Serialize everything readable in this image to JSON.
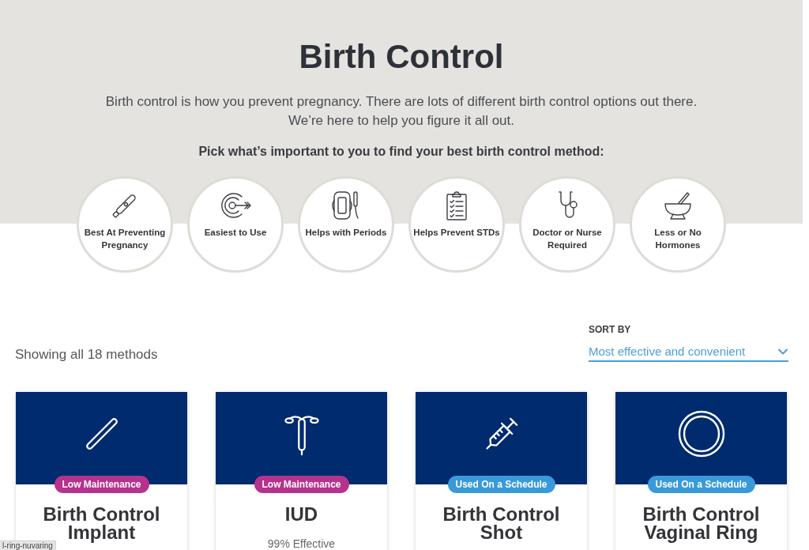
{
  "header": {
    "title": "Birth Control",
    "intro": "Birth control is how you prevent pregnancy. There are lots of different birth control options out there. We’re here to help you figure it all out.",
    "prompt": "Pick what’s important to you to find your best birth control method:"
  },
  "filters": [
    {
      "label": "Best At Preventing Pregnancy",
      "selected": false
    },
    {
      "label": "Easiest to Use",
      "selected": false
    },
    {
      "label": "Helps with Periods",
      "selected": false
    },
    {
      "label": "Helps Prevent STDs",
      "selected": false
    },
    {
      "label": "Doctor or Nurse Required",
      "selected": false
    },
    {
      "label": "Less or No Hormones",
      "selected": false
    }
  ],
  "results": {
    "count_text": "Showing all 18 methods",
    "sort": {
      "label": "SORT BY",
      "value": "Most effective and convenient"
    }
  },
  "cards": [
    {
      "badge": {
        "text": "Low Maintenance",
        "color": "#b5338c"
      },
      "title": "Birth Control Implant"
    },
    {
      "badge": {
        "text": "Low Maintenance",
        "color": "#b5338c"
      },
      "title": "IUD",
      "effectiveness": "99% Effective"
    },
    {
      "badge": {
        "text": "Used On a Schedule",
        "color": "#3a9ad9"
      },
      "title": "Birth Control Shot"
    },
    {
      "badge": {
        "text": "Used On a Schedule",
        "color": "#3a9ad9"
      },
      "title": "Birth Control Vaginal Ring"
    }
  ],
  "status_bar": {
    "url": "l-ring-nuvaring"
  }
}
